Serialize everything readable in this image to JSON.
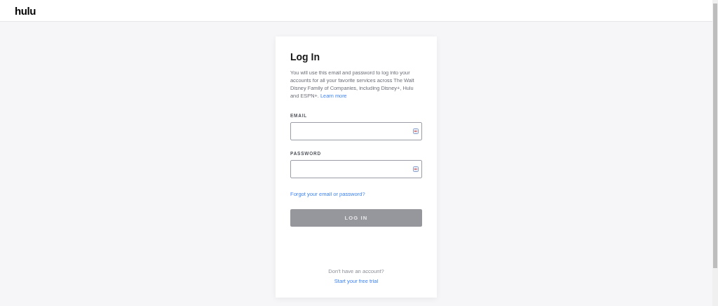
{
  "header": {
    "logo": "hulu"
  },
  "login": {
    "title": "Log In",
    "intro": "You will use this email and password to log into your accounts for all your favorite services across The Walt Disney Family of Companies, including Disney+, Hulu and ESPN+.",
    "intro_link": "Learn more",
    "fields": [
      {
        "label": "EMAIL"
      },
      {
        "label": "PASSWORD"
      }
    ],
    "forgot_link": "Forgot your email or password?",
    "submit": {
      "label": "LOG IN",
      "disabled": true
    },
    "signup_prompt": "Don't have an account?",
    "signup_link": "Start your free trial"
  }
}
